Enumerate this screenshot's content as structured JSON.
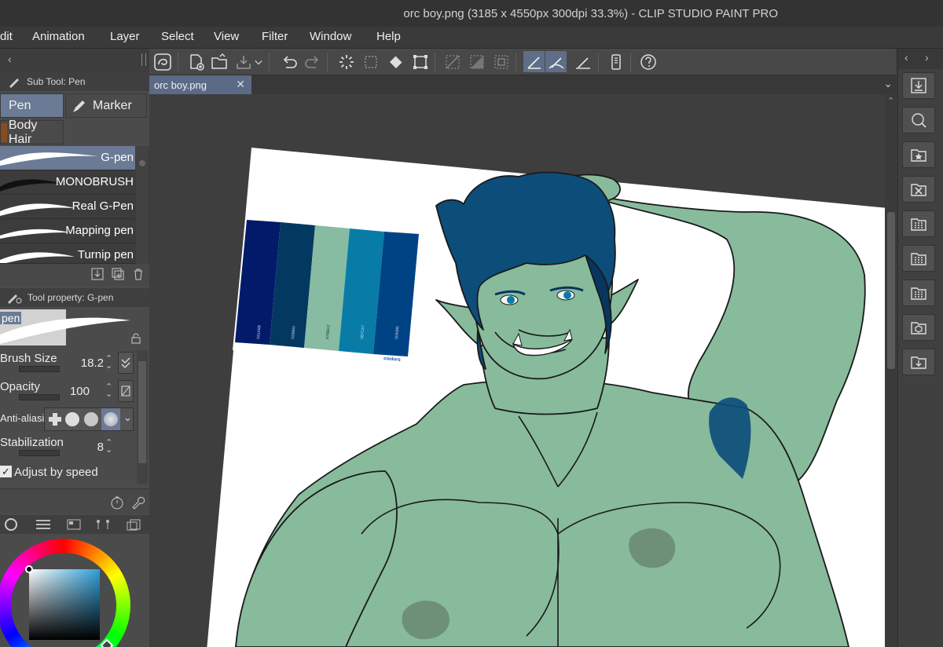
{
  "window": {
    "title": "orc boy.png (3185 x 4550px 300dpi 33.3%)  - CLIP STUDIO PAINT PRO"
  },
  "menu": [
    "dit",
    "Animation",
    "Layer",
    "Select",
    "View",
    "Filter",
    "Window",
    "Help"
  ],
  "subtool": {
    "header": "Sub Tool: Pen",
    "tabs": [
      "Pen",
      "Marker",
      "Body Hair"
    ],
    "brushes": [
      "G-pen",
      "MONOBRUSH",
      "Real G-Pen",
      "Mapping pen",
      "Turnip pen"
    ]
  },
  "tool_property": {
    "header": "Tool property: G-pen",
    "preview_label": "pen",
    "brush_size": {
      "label": "Brush Size",
      "value": "18.2"
    },
    "opacity": {
      "label": "Opacity",
      "value": "100"
    },
    "anti_aliasing": {
      "label": "Anti-aliasin"
    },
    "stabilization": {
      "label": "Stabilization",
      "value": "8"
    },
    "adjust_by_speed": {
      "label": "Adjust by speed",
      "checked": true
    }
  },
  "document": {
    "tab_label": "orc boy.png"
  },
  "palette": {
    "swatches": [
      {
        "hex": "#031A6B",
        "label": "031A6B"
      },
      {
        "hex": "#033860",
        "label": "033860"
      },
      {
        "hex": "#87BBA2",
        "label": "87BBA2"
      },
      {
        "hex": "#087CA7",
        "label": "087CA7"
      },
      {
        "hex": "#004385",
        "label": "004385"
      }
    ],
    "brand": "coolors"
  },
  "colors": {
    "skin": "#87bb9c",
    "skin_shadow": "#6e8f78",
    "hair": "#0c4d7a",
    "hair_dark": "#073660",
    "accent": "#5e6d88",
    "color_square": "#2fa0d8"
  }
}
